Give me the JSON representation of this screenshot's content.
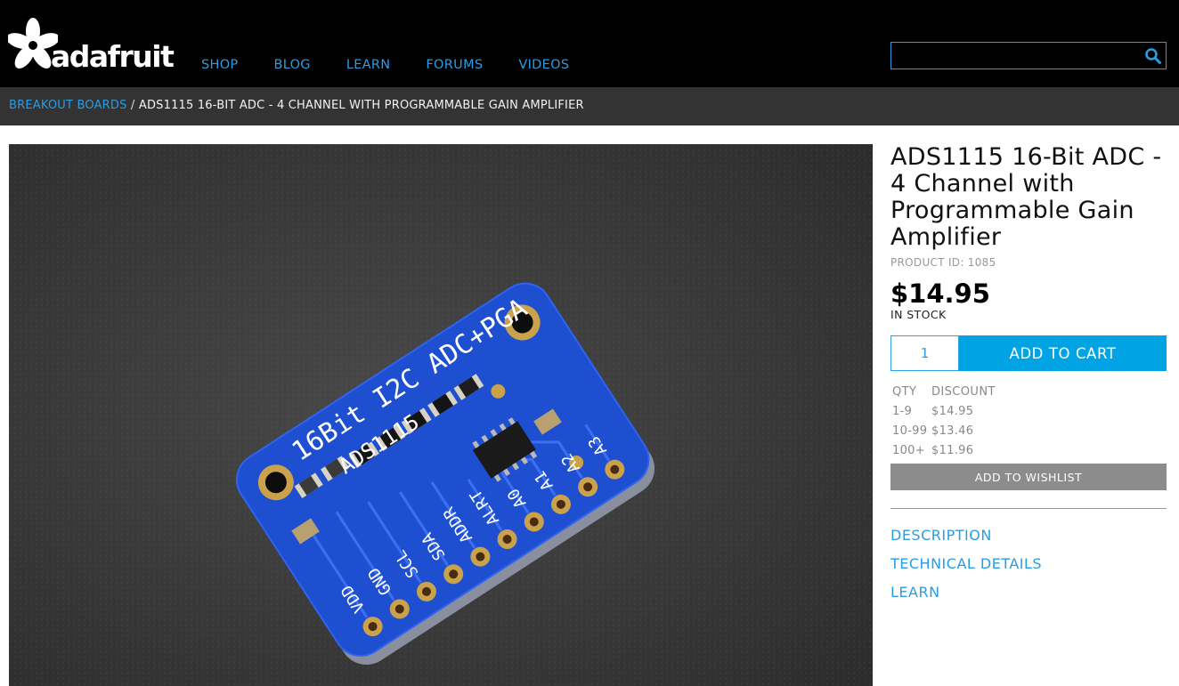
{
  "header": {
    "logo_text": "adafruit",
    "nav": [
      "SHOP",
      "BLOG",
      "LEARN",
      "FORUMS",
      "VIDEOS"
    ],
    "search": {
      "value": "",
      "placeholder": ""
    }
  },
  "breadcrumb": {
    "parent": "BREAKOUT BOARDS",
    "separator": "/",
    "current": "ADS1115 16-BIT ADC - 4 CHANNEL WITH PROGRAMMABLE GAIN AMPLIFIER"
  },
  "product": {
    "title": "ADS1115 16-Bit ADC - 4 Channel with Programmable Gain Amplifier",
    "product_id": "PRODUCT ID: 1085",
    "price": "$14.95",
    "stock": "IN STOCK",
    "quantity": "1",
    "add_to_cart": "ADD TO CART",
    "add_to_wishlist": "ADD TO WISHLIST",
    "discount_table": {
      "headers": [
        "QTY",
        "DISCOUNT"
      ],
      "rows": [
        [
          "1-9",
          "$14.95"
        ],
        [
          "10-99",
          "$13.46"
        ],
        [
          "100+",
          "$11.96"
        ]
      ]
    },
    "tabs": [
      "DESCRIPTION",
      "TECHNICAL DETAILS",
      "LEARN"
    ]
  },
  "board": {
    "pins": [
      "VDD",
      "GND",
      "SCL",
      "SDA",
      "ADDR",
      "ALRT",
      "A0",
      "A1",
      "A2",
      "A3"
    ],
    "silkscreen_title": "16Bit I2C ADC+PGA",
    "silkscreen_chip": "ADS1115"
  },
  "colors": {
    "header_bg": "#000000",
    "breadcrumb_bg": "#333333",
    "link_blue": "#2a9ce4",
    "cart_blue": "#00a4e4",
    "wishlist_gray": "#8c8c8c",
    "pcb_blue": "#1f4fd1"
  },
  "icons": {
    "logo": "adafruit-flower-icon",
    "search": "search-icon"
  }
}
